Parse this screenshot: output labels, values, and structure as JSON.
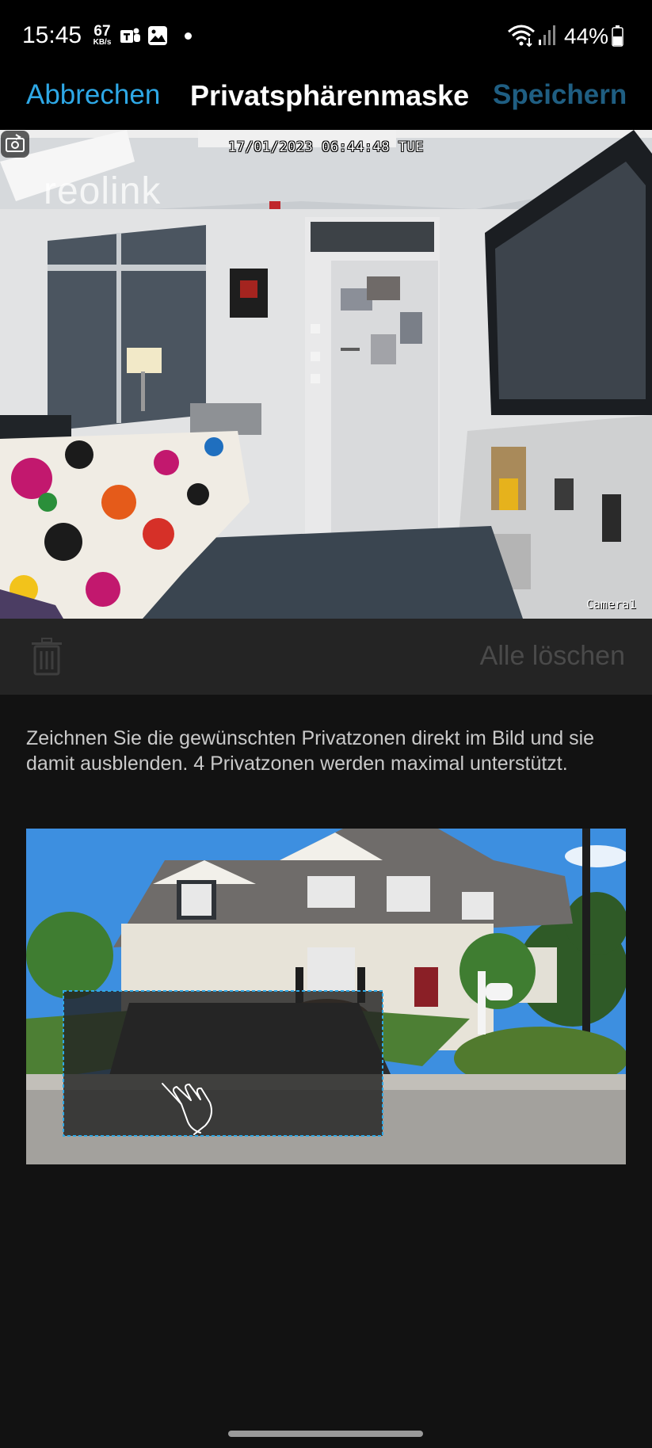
{
  "status_bar": {
    "time": "15:45",
    "net_speed_value": "67",
    "net_speed_unit": "KB/s",
    "battery_percent": "44%",
    "icons": [
      "teams-icon",
      "gallery-icon",
      "notification-dot-icon",
      "wifi-icon",
      "signal-icon",
      "battery-icon"
    ]
  },
  "header": {
    "cancel_label": "Abbrechen",
    "title": "Privatsphärenmaske",
    "save_label": "Speichern"
  },
  "camera": {
    "timestamp": "17/01/2023 06:44:48 TUE",
    "watermark": "reolink",
    "camera_name": "Camera1"
  },
  "toolbar": {
    "clear_all_label": "Alle löschen",
    "delete_icon": "trash-icon"
  },
  "instructions": {
    "text": "Zeichnen Sie die gewünschten Privatzonen direkt im Bild und sie damit ausblenden. 4 Privatzonen werden maximal unterstützt."
  },
  "colors": {
    "accent": "#2ea8e6",
    "save_disabled": "#1f5e82",
    "background": "#121212",
    "toolbar": "#242424"
  }
}
